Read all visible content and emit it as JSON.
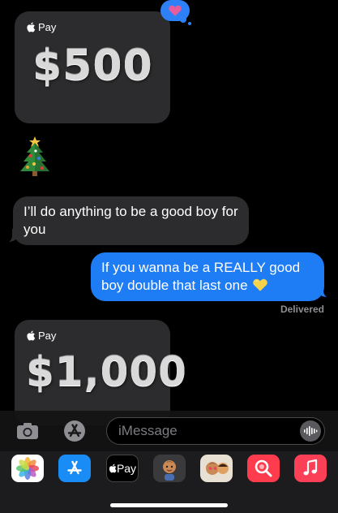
{
  "conversation": {
    "pay_card_top": {
      "brand": "Pay",
      "amount": "$500"
    },
    "tapback": {
      "icon": "heart-icon",
      "color": "#e85c9c"
    },
    "emoji_message": {
      "icon": "christmas-tree-icon"
    },
    "incoming_message": "I’ll do anything to be a good boy for you",
    "outgoing_message": "If you wanna be a REALLY good boy double that last one",
    "outgoing_emoji": "yellow-heart-icon",
    "status": "Delivered",
    "pay_card_bottom": {
      "brand": "Pay",
      "amount": "$1,000"
    }
  },
  "input_bar": {
    "placeholder": "iMessage",
    "camera_icon": "camera-icon",
    "apps_icon": "app-store-icon",
    "audio_icon": "audio-waveform-icon"
  },
  "app_drawer": {
    "apps": [
      {
        "name": "Photos",
        "icon": "photos-icon"
      },
      {
        "name": "App Store",
        "icon": "app-store-icon"
      },
      {
        "name": "Apple Pay",
        "label": "Pay",
        "icon": "apple-pay-icon"
      },
      {
        "name": "Memoji",
        "icon": "memoji-icon"
      },
      {
        "name": "Memoji Stickers",
        "icon": "memoji-stickers-icon"
      },
      {
        "name": "Images Search",
        "icon": "image-search-icon"
      },
      {
        "name": "Music",
        "icon": "music-icon"
      }
    ]
  },
  "colors": {
    "background": "#000000",
    "incoming_bubble": "#2c2c2e",
    "outgoing_bubble": "#1e7cf5",
    "status_text": "#8e8e93"
  }
}
